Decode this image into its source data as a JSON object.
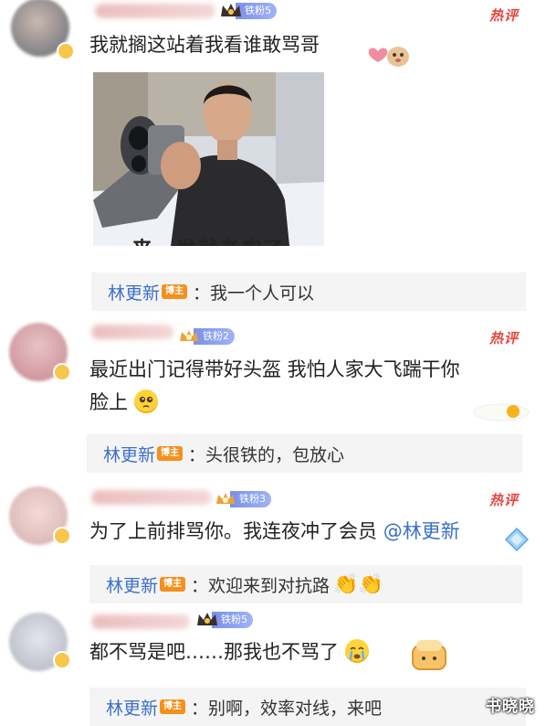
{
  "comments": [
    {
      "fan_badge": "铁粉5",
      "hot_label": "热评",
      "text": "我就搁这站着我看谁敢骂哥",
      "image_caption": "来一发就老实了",
      "reply": {
        "name": "林更新",
        "tag": "博主",
        "text": "：我一个人可以"
      }
    },
    {
      "fan_badge": "铁粉2",
      "hot_label": "热评",
      "text_line1": "最近出门记得带好头盔 我怕人家大飞踹干你",
      "text_line2": "脸上",
      "reply": {
        "name": "林更新",
        "tag": "博主",
        "text": "：头很铁的，包放心"
      }
    },
    {
      "fan_badge": "铁粉3",
      "hot_label": "热评",
      "text": "为了上前排骂你。我连夜冲了会员",
      "mention": "@林更新",
      "reply": {
        "name": "林更新",
        "tag": "博主",
        "text": "：欢迎来到对抗路"
      }
    },
    {
      "fan_badge": "铁粉5",
      "text": "都不骂是吧……那我也不骂了",
      "reply": {
        "name": "林更新",
        "tag": "博主",
        "text": "：别啊，效率对线，来吧"
      }
    }
  ],
  "watermark": "书晓晓",
  "colors": {
    "hot": "#e8453c",
    "link": "#3b6fc8",
    "blogger_tag": "#f4901e",
    "reply_bg": "#f4f4f5"
  }
}
